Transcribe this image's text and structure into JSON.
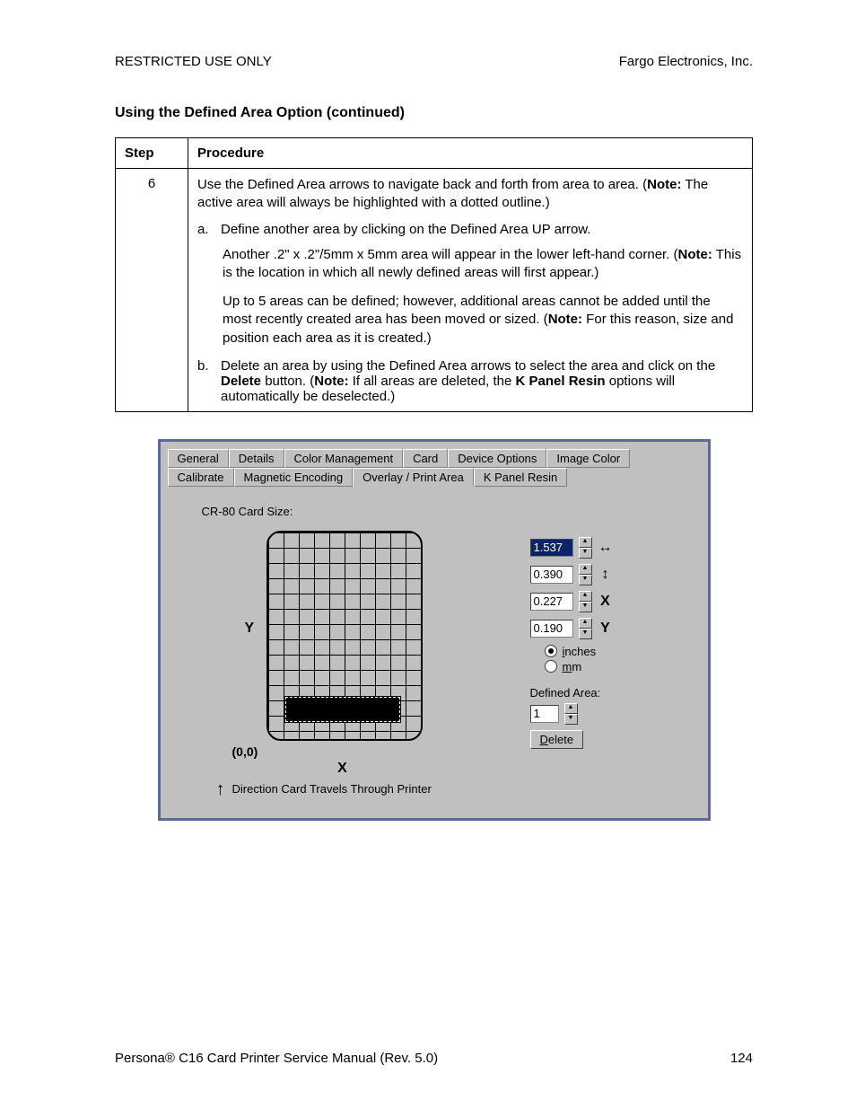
{
  "header": {
    "left": "RESTRICTED USE ONLY",
    "right": "Fargo Electronics, Inc."
  },
  "section_title": "Using the Defined Area Option (continued)",
  "table": {
    "head_step": "Step",
    "head_proc": "Procedure",
    "step_num": "6",
    "intro_a": "Use the Defined Area arrows to navigate back and forth from area to area. (",
    "intro_bold": "Note:",
    "intro_b": "  The active area will always be highlighted with a dotted outline.)",
    "a_label": "a.",
    "a_text": "Define another area by clicking on the Defined Area UP arrow.",
    "a_sub1_a": "Another .2\" x .2\"/5mm x 5mm area will appear in the lower left-hand corner. (",
    "a_sub1_bold": "Note:",
    "a_sub1_b": " This is the location in which all newly defined areas will first appear.)",
    "a_sub2_a": "Up to 5 areas can be defined; however, additional areas cannot be added until the most recently created area has been moved or sized. (",
    "a_sub2_bold": "Note:",
    "a_sub2_b": " For this reason, size and position each area as it is created.)",
    "b_label": "b.",
    "b_text_a": "Delete an area by using the Defined Area arrows to select the area and click on the ",
    "b_bold1": "Delete",
    "b_text_b": " button. (",
    "b_bold2": "Note:",
    "b_text_c": "  If all areas are deleted, the ",
    "b_bold3": "K Panel Resin",
    "b_text_d": " options will automatically be deselected.)"
  },
  "dialog": {
    "tabs_row1": [
      "General",
      "Details",
      "Color Management",
      "Card",
      "Device Options",
      "Image Color"
    ],
    "tabs_row2": [
      "Calibrate",
      "Magnetic Encoding",
      "Overlay / Print Area",
      "K Panel Resin"
    ],
    "active_tab": "Overlay / Print Area",
    "card_size_label": "CR-80 Card Size:",
    "y_label": "Y",
    "x_label": "X",
    "origin": "(0,0)",
    "direction_text": "Direction Card Travels Through Printer",
    "spinners": [
      {
        "value": "1.537",
        "icon": "↔",
        "hl": true,
        "name": "width"
      },
      {
        "value": "0.390",
        "icon": "↕",
        "hl": false,
        "name": "height"
      },
      {
        "value": "0.227",
        "icon": "X",
        "hl": false,
        "name": "x"
      },
      {
        "value": "0.190",
        "icon": "Y",
        "hl": false,
        "name": "y"
      }
    ],
    "unit_inches": "inches",
    "unit_mm": "mm",
    "defined_area_label": "Defined Area:",
    "defined_area_value": "1",
    "delete_label": "Delete"
  },
  "footer": {
    "left": "Persona® C16 Card Printer Service Manual (Rev. 5.0)",
    "right": "124"
  }
}
